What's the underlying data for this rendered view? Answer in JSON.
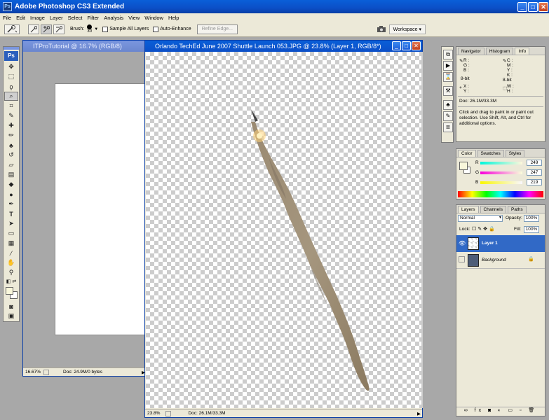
{
  "app": {
    "title": "Adobe Photoshop CS3 Extended",
    "logo_text": "Ps",
    "minimize": "_",
    "maximize": "□",
    "close": "✕"
  },
  "menu": [
    "File",
    "Edit",
    "Image",
    "Layer",
    "Select",
    "Filter",
    "Analysis",
    "View",
    "Window",
    "Help"
  ],
  "options": {
    "brush_label": "Brush:",
    "brush_size": "30",
    "sample_all_layers": "Sample All Layers",
    "auto_enhance": "Auto-Enhance",
    "refine_edge": "Refine Edge...",
    "workspace": "Workspace ▾"
  },
  "doc1": {
    "title": "ITProTutorial @ 16.7% (RGB/8)",
    "zoom": "16.67%",
    "status": "Doc: 24.9M/0 bytes"
  },
  "doc2": {
    "title": "Orlando TechEd June 2007 Shuttle Launch 053.JPG @ 23.8% (Layer 1, RGB/8*)",
    "zoom": "23.8%",
    "status": "Doc: 26.1M/33.3M"
  },
  "info": {
    "tabs": [
      "Navigator",
      "Histogram",
      "Info"
    ],
    "r": "R :",
    "g": "G :",
    "b": "B :",
    "c": "C :",
    "m": "M :",
    "y": "Y :",
    "k": "K :",
    "bit1": "8-bit",
    "bit2": "8-bit",
    "x": "X :",
    "yy": "Y :",
    "w": "W :",
    "h": "H :",
    "doc": "Doc: 26.1M/33.3M",
    "hint": "Click and drag to paint in or paint out selection.  Use Shift, Alt, and Ctrl for additional options."
  },
  "color": {
    "tabs": [
      "Color",
      "Swatches",
      "Styles"
    ],
    "r_label": "R",
    "g_label": "G",
    "b_label": "B",
    "r": "249",
    "g": "247",
    "b": "219",
    "fg": "#f9f7db"
  },
  "layers": {
    "tabs": [
      "Layers",
      "Channels",
      "Paths"
    ],
    "blend": "Normal",
    "opacity_label": "Opacity:",
    "opacity": "100%",
    "lock_label": "Lock:",
    "fill_label": "Fill:",
    "fill": "100%",
    "items": [
      {
        "name": "Layer 1"
      },
      {
        "name": "Background"
      }
    ],
    "footer_icons": "∞ fx ◙ ◐ ▭ ▫ 🗑"
  }
}
